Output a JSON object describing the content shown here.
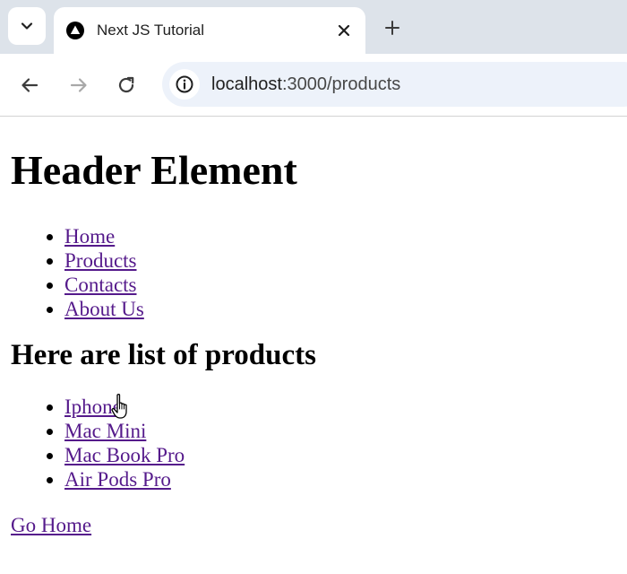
{
  "browser": {
    "tab": {
      "title": "Next JS Tutorial",
      "favicon_icon": "nextjs-triangle-icon",
      "close_icon": "close-icon"
    },
    "tab_search_icon": "chevron-down-icon",
    "new_tab_icon": "plus-icon",
    "toolbar": {
      "back_icon": "arrow-left-icon",
      "forward_icon": "arrow-right-icon",
      "reload_icon": "reload-icon",
      "site_info_icon": "info-icon",
      "url_host": "localhost",
      "url_rest": ":3000/products"
    }
  },
  "page": {
    "header_title": "Header Element",
    "nav_items": [
      {
        "label": "Home"
      },
      {
        "label": "Products"
      },
      {
        "label": "Contacts"
      },
      {
        "label": "About Us"
      }
    ],
    "products_heading": "Here are list of products",
    "products": [
      {
        "label": "Iphone"
      },
      {
        "label": "Mac Mini"
      },
      {
        "label": "Mac Book Pro"
      },
      {
        "label": "Air Pods Pro"
      }
    ],
    "go_home_label": "Go Home",
    "cursor_icon": "hand-pointer-icon"
  },
  "colors": {
    "tabstrip_bg": "#dde3ea",
    "omnibox_bg": "#edf2fa",
    "link_visited": "#551a8b"
  }
}
